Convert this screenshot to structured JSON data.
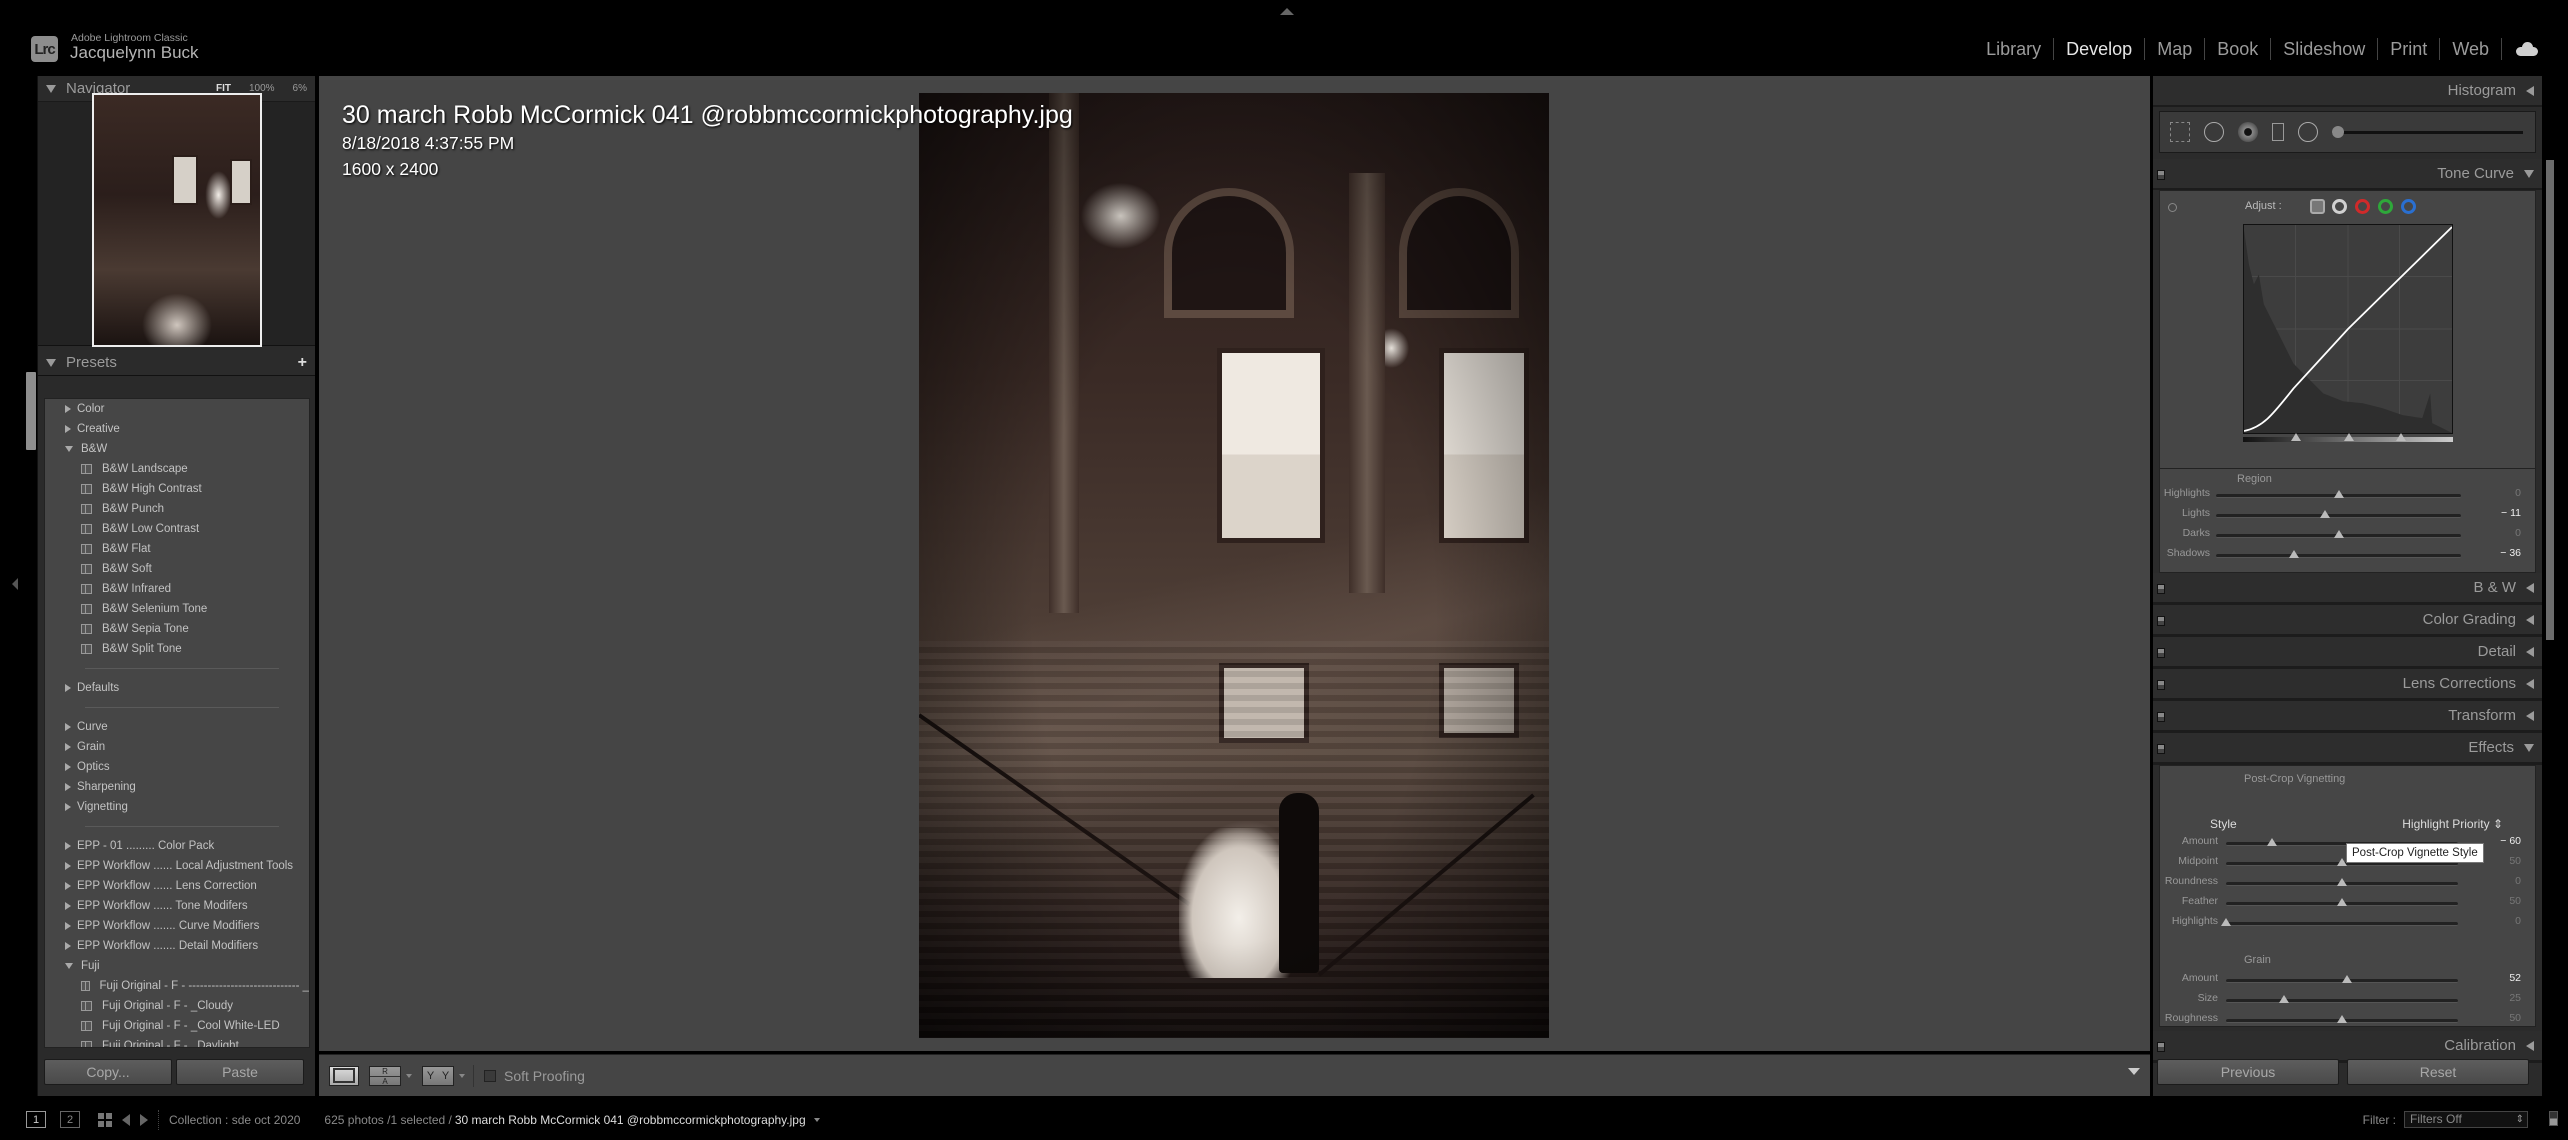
{
  "app": {
    "product_name": "Adobe Lightroom Classic",
    "user_name": "Jacquelynn Buck",
    "logo_text": "Lrc"
  },
  "modules": {
    "items": [
      "Library",
      "Develop",
      "Map",
      "Book",
      "Slideshow",
      "Print",
      "Web"
    ],
    "active": "Develop",
    "cloud_icon": "cloud-icon"
  },
  "navigator": {
    "title": "Navigator",
    "zoom_options": [
      "FIT",
      "100%",
      "6%"
    ]
  },
  "presets": {
    "title": "Presets",
    "add_icon": "plus-icon",
    "rows": [
      {
        "type": "folder",
        "label": "Color",
        "open": false
      },
      {
        "type": "folder",
        "label": "Creative",
        "open": false
      },
      {
        "type": "folder",
        "label": "B&W",
        "open": true
      },
      {
        "type": "item",
        "label": "B&W Landscape"
      },
      {
        "type": "item",
        "label": "B&W High Contrast"
      },
      {
        "type": "item",
        "label": "B&W Punch"
      },
      {
        "type": "item",
        "label": "B&W Low Contrast"
      },
      {
        "type": "item",
        "label": "B&W Flat"
      },
      {
        "type": "item",
        "label": "B&W Soft"
      },
      {
        "type": "item",
        "label": "B&W Infrared"
      },
      {
        "type": "item",
        "label": "B&W Selenium Tone"
      },
      {
        "type": "item",
        "label": "B&W Sepia Tone"
      },
      {
        "type": "item",
        "label": "B&W Split Tone"
      },
      {
        "type": "separator"
      },
      {
        "type": "folder",
        "label": "Defaults",
        "open": false
      },
      {
        "type": "separator"
      },
      {
        "type": "folder",
        "label": "Curve",
        "open": false
      },
      {
        "type": "folder",
        "label": "Grain",
        "open": false
      },
      {
        "type": "folder",
        "label": "Optics",
        "open": false
      },
      {
        "type": "folder",
        "label": "Sharpening",
        "open": false
      },
      {
        "type": "folder",
        "label": "Vignetting",
        "open": false
      },
      {
        "type": "separator"
      },
      {
        "type": "folder",
        "label": "EPP - 01 ......... Color Pack",
        "open": false
      },
      {
        "type": "folder",
        "label": "EPP Workflow ...... Local Adjustment Tools",
        "open": false
      },
      {
        "type": "folder",
        "label": "EPP Workflow ...... Lens Correction",
        "open": false
      },
      {
        "type": "folder",
        "label": "EPP Workflow ...... Tone Modifers",
        "open": false
      },
      {
        "type": "folder",
        "label": "EPP Workflow ....... Curve Modifiers",
        "open": false
      },
      {
        "type": "folder",
        "label": "EPP Workflow ....... Detail Modifiers",
        "open": false
      },
      {
        "type": "folder",
        "label": "Fuji",
        "open": true
      },
      {
        "type": "item",
        "label": "Fuji Original - F -  ----------------------------- _"
      },
      {
        "type": "item",
        "label": "Fuji Original - F - _Cloudy"
      },
      {
        "type": "item",
        "label": "Fuji Original - F - _Cool White-LED"
      },
      {
        "type": "item",
        "label": "Fuji Original - F - _Daylight"
      }
    ],
    "copy_label": "Copy...",
    "paste_label": "Paste"
  },
  "photo": {
    "filename": "30 march Robb McCormick 041 @robbmccormickphotography.jpg",
    "datetime": "8/18/2018 4:37:55 PM",
    "dimensions": "1600 x 2400"
  },
  "toolbar": {
    "ra_label_top": "R",
    "ra_label_bottom": "A",
    "yy_label": "Y",
    "soft_proofing_label": "Soft Proofing",
    "soft_proofing_checked": false
  },
  "right_panel": {
    "histogram_title": "Histogram",
    "tone_curve": {
      "title": "Tone Curve",
      "adjust_label": "Adjust :",
      "channels": [
        {
          "name": "parametric",
          "color": "#b0b0b0"
        },
        {
          "name": "point-rgb",
          "color": "#d0d0d0"
        },
        {
          "name": "red",
          "color": "#d02a2a"
        },
        {
          "name": "green",
          "color": "#2ea83a"
        },
        {
          "name": "blue",
          "color": "#2a6fd0"
        }
      ],
      "region_label": "Region",
      "region_sliders": [
        {
          "label": "Highlights",
          "value": "0",
          "fraction": 0.5,
          "changed": false
        },
        {
          "label": "Lights",
          "value": "− 11",
          "fraction": 0.445,
          "changed": true
        },
        {
          "label": "Darks",
          "value": "0",
          "fraction": 0.5,
          "changed": false
        },
        {
          "label": "Shadows",
          "value": "− 36",
          "fraction": 0.32,
          "changed": true
        }
      ]
    },
    "collapsed_panels": [
      "B & W",
      "Color Grading",
      "Detail",
      "Lens Corrections",
      "Transform"
    ],
    "effects": {
      "title": "Effects",
      "vignette_label": "Post-Crop Vignetting",
      "style_label": "Style",
      "style_value": "Highlight Priority",
      "tooltip": "Post-Crop Vignette Style",
      "vignette_sliders": [
        {
          "label": "Amount",
          "value": "− 60",
          "fraction": 0.2,
          "changed": true
        },
        {
          "label": "Midpoint",
          "value": "50",
          "fraction": 0.5,
          "changed": false
        },
        {
          "label": "Roundness",
          "value": "0",
          "fraction": 0.5,
          "changed": false
        },
        {
          "label": "Feather",
          "value": "50",
          "fraction": 0.5,
          "changed": false
        },
        {
          "label": "Highlights",
          "value": "0",
          "fraction": 0.0,
          "changed": false
        }
      ],
      "grain_label": "Grain",
      "grain_sliders": [
        {
          "label": "Amount",
          "value": "52",
          "fraction": 0.52,
          "changed": true
        },
        {
          "label": "Size",
          "value": "25",
          "fraction": 0.25,
          "changed": false
        },
        {
          "label": "Roughness",
          "value": "50",
          "fraction": 0.5,
          "changed": false
        }
      ]
    },
    "calibration_title": "Calibration",
    "previous_label": "Previous",
    "reset_label": "Reset"
  },
  "statusbar": {
    "screen1": "1",
    "screen2": "2",
    "collection": "Collection : sde oct 2020",
    "count": "625 photos /1 selected /",
    "current_file": "30 march Robb McCormick 041 @robbmccormickphotography.jpg",
    "filter_label": "Filter :",
    "filter_value": "Filters Off"
  }
}
